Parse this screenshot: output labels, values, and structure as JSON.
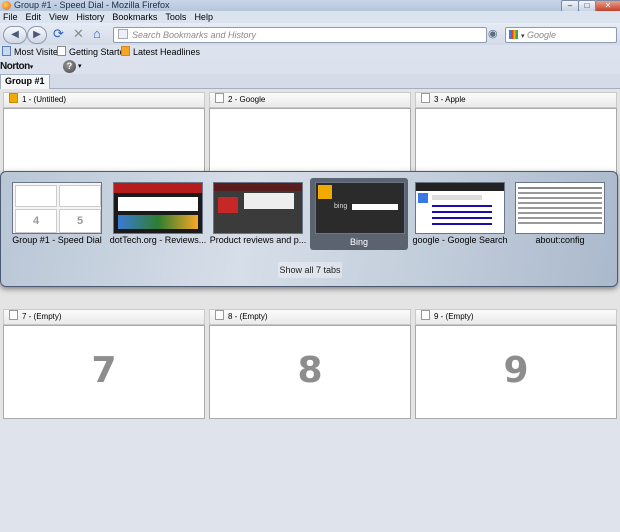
{
  "window": {
    "title": "Group #1 - Speed Dial - Mozilla Firefox",
    "btn_min": "‒",
    "btn_max": "□",
    "btn_close": "✕"
  },
  "menu": [
    "File",
    "Edit",
    "View",
    "History",
    "Bookmarks",
    "Tools",
    "Help"
  ],
  "nav": {
    "back": "◀",
    "forward": "▶",
    "reload_icon": "reload-icon",
    "stop_icon": "stop-icon",
    "home_icon": "home-icon",
    "url_placeholder": "Search Bookmarks and History",
    "search_placeholder": "Google"
  },
  "bookmarks": [
    "Most Visited",
    "Getting Started",
    "Latest Headlines"
  ],
  "toolbar": {
    "norton": "Norton",
    "norton_arrow": "▾",
    "help": "?",
    "help_arrow": "▾"
  },
  "tabs": [
    "Group #1"
  ],
  "dials": [
    {
      "title": "1 - (Untitled)",
      "number": ""
    },
    {
      "title": "2 - Google",
      "number": ""
    },
    {
      "title": "3 - Apple",
      "number": ""
    },
    {
      "title": "7 - (Empty)",
      "number": "7"
    },
    {
      "title": "8 - (Empty)",
      "number": "8"
    },
    {
      "title": "9 - (Empty)",
      "number": "9"
    }
  ],
  "switcher": {
    "items": [
      "Group #1 - Speed Dial",
      "dotTech.org - Reviews...",
      "Product reviews and p...",
      "Bing",
      "google - Google Search",
      "about:config"
    ],
    "selected_index": 3,
    "show_all": "Show all 7 tabs",
    "thumb1_numbers": [
      "4",
      "5"
    ],
    "bing_word": "bing"
  },
  "colors": {
    "accent": "#2d62b8",
    "selected_thumb": "#5b6371",
    "bing": "#f2a900"
  }
}
